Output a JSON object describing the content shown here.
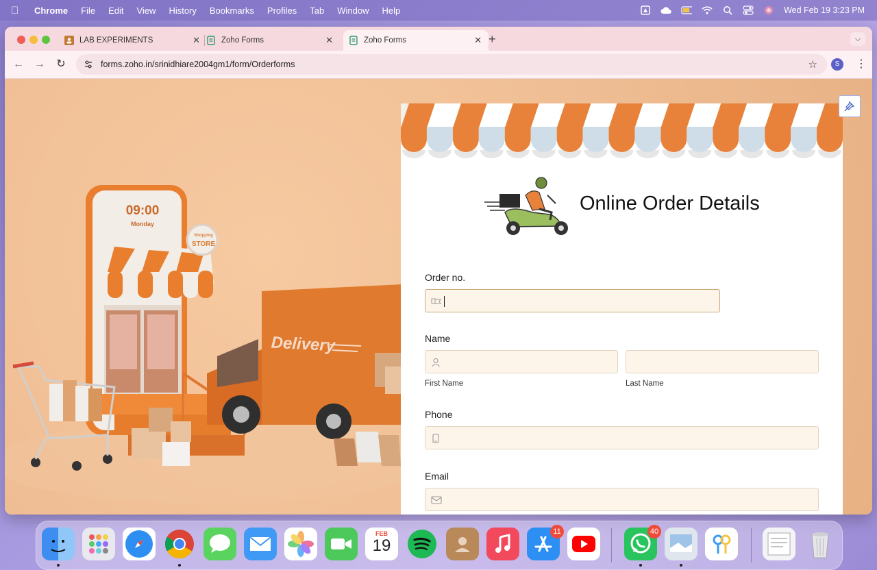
{
  "menubar": {
    "app_name": "Chrome",
    "items": [
      "File",
      "Edit",
      "View",
      "History",
      "Bookmarks",
      "Profiles",
      "Tab",
      "Window",
      "Help"
    ],
    "datetime": "Wed Feb 19  3:23 PM"
  },
  "browser": {
    "tabs": [
      {
        "title": "LAB EXPERIMENTS",
        "icon": "classroom-icon",
        "active": false
      },
      {
        "title": "Zoho Forms",
        "icon": "zoho-forms-icon",
        "active": false
      },
      {
        "title": "Zoho Forms",
        "icon": "zoho-forms-icon",
        "active": true
      }
    ],
    "url": "forms.zoho.in/srinidhiare2004gm1/form/Orderforms",
    "profile_initial": "S"
  },
  "hero": {
    "clock_time": "09:00",
    "clock_day": "Monday",
    "store_sign_line1": "Shopping",
    "store_sign_line2": "STORE",
    "truck_label": "Delivery"
  },
  "form": {
    "title": "Online Order Details",
    "fields": {
      "order_no": {
        "label": "Order no.",
        "value": ""
      },
      "name": {
        "label": "Name",
        "first_label": "First Name",
        "last_label": "Last Name"
      },
      "phone": {
        "label": "Phone",
        "value": ""
      },
      "email": {
        "label": "Email",
        "value": ""
      }
    }
  },
  "dock": {
    "calendar_month": "FEB",
    "calendar_day": "19",
    "app_store_badge": "11",
    "whatsapp_badge": "40"
  },
  "colors": {
    "accent_orange": "#e8823a",
    "awning_light": "#cfdde9",
    "field_bg": "#fef5ea"
  }
}
